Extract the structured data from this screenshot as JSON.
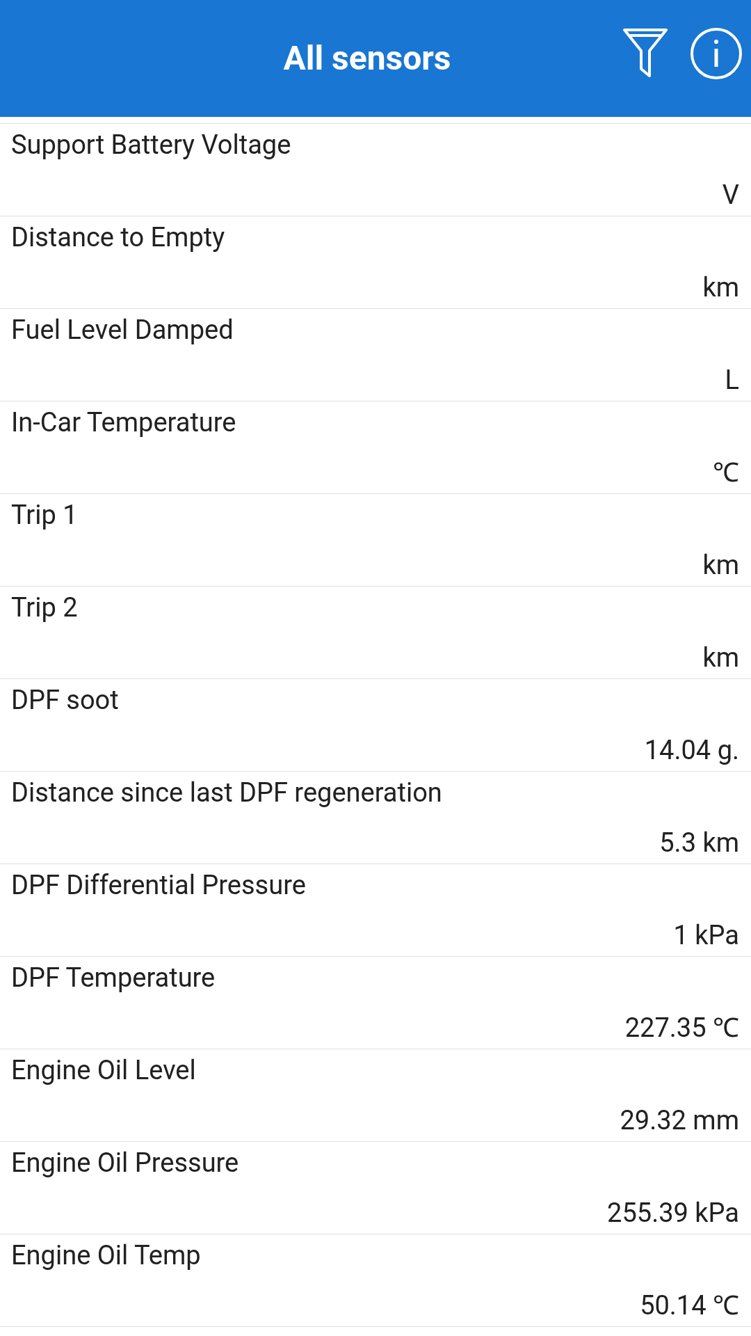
{
  "header": {
    "title": "All sensors"
  },
  "sensors": [
    {
      "name": "Support Battery Voltage",
      "value": "V"
    },
    {
      "name": "Distance to Empty",
      "value": "km"
    },
    {
      "name": "Fuel Level Damped",
      "value": "L"
    },
    {
      "name": "In-Car Temperature",
      "value": "℃"
    },
    {
      "name": "Trip 1",
      "value": "km"
    },
    {
      "name": "Trip 2",
      "value": "km"
    },
    {
      "name": "DPF soot",
      "value": "14.04 g."
    },
    {
      "name": "Distance since last DPF regeneration",
      "value": "5.3 km"
    },
    {
      "name": "DPF Differential Pressure",
      "value": "1 kPa"
    },
    {
      "name": "DPF Temperature",
      "value": "227.35 ℃"
    },
    {
      "name": "Engine Oil Level",
      "value": "29.32 mm"
    },
    {
      "name": "Engine Oil Pressure",
      "value": "255.39 kPa"
    },
    {
      "name": "Engine Oil Temp",
      "value": "50.14 ℃"
    }
  ]
}
